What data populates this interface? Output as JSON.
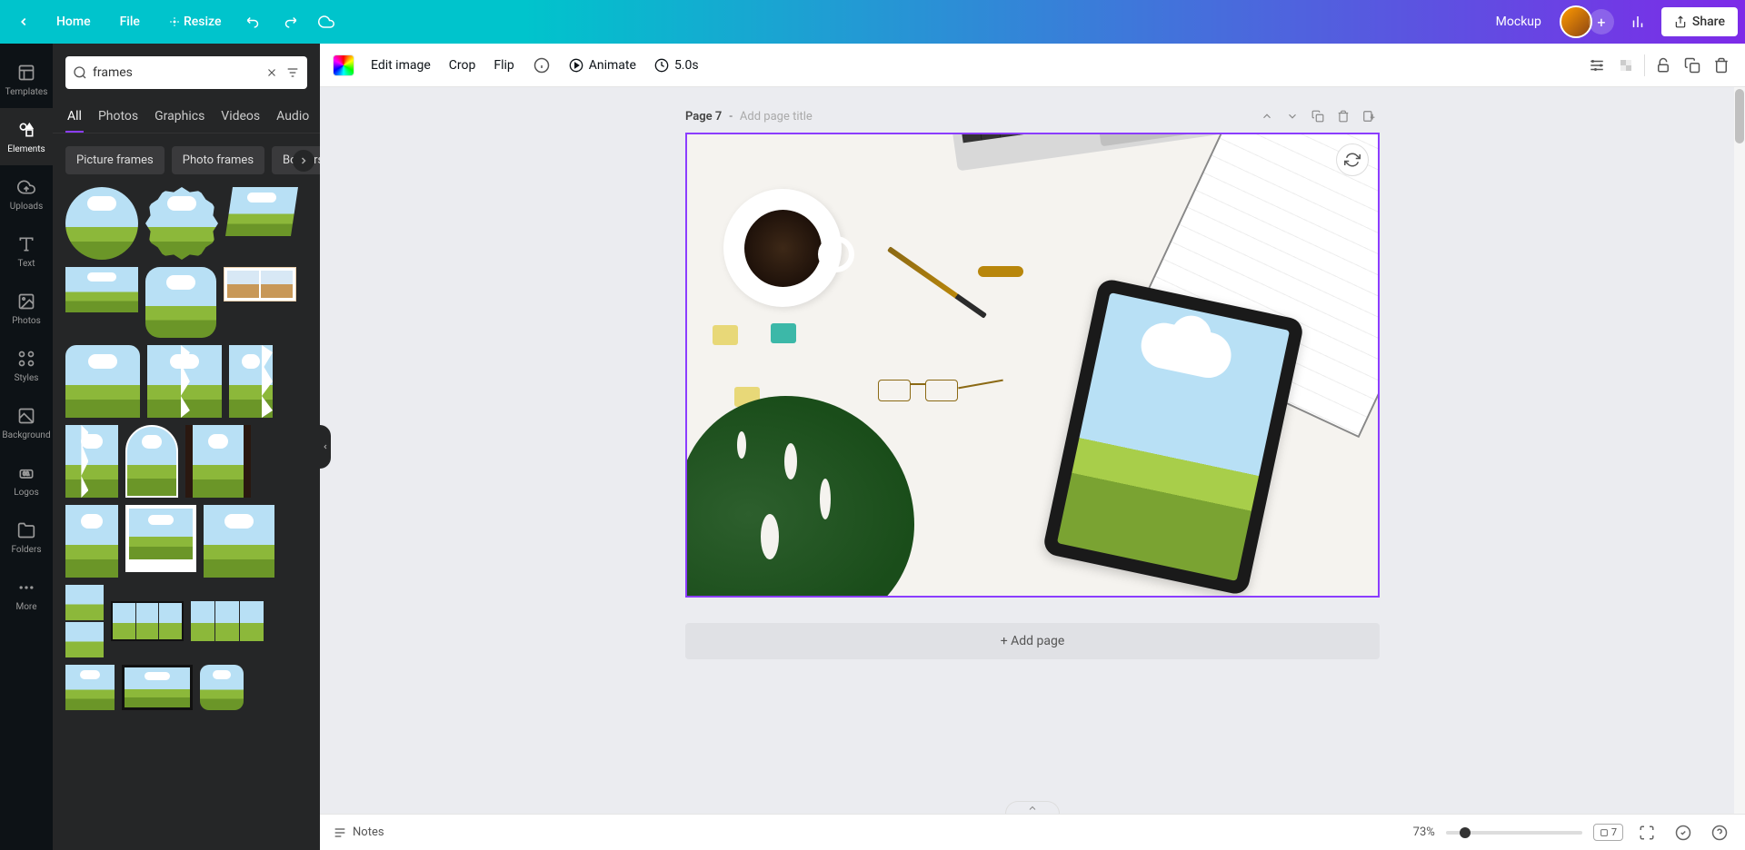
{
  "topbar": {
    "home": "Home",
    "file": "File",
    "resize": "Resize",
    "title": "Mockup",
    "share": "Share"
  },
  "leftnav": {
    "templates": "Templates",
    "elements": "Elements",
    "uploads": "Uploads",
    "text": "Text",
    "photos": "Photos",
    "styles": "Styles",
    "background": "Background",
    "logos": "Logos",
    "folders": "Folders",
    "more": "More"
  },
  "search": {
    "value": "frames"
  },
  "tabs": {
    "all": "All",
    "photos": "Photos",
    "graphics": "Graphics",
    "videos": "Videos",
    "audio": "Audio"
  },
  "chips": {
    "picture_frames": "Picture frames",
    "photo_frames": "Photo frames",
    "borders": "Borders"
  },
  "toolbar": {
    "edit_image": "Edit image",
    "crop": "Crop",
    "flip": "Flip",
    "animate": "Animate",
    "duration": "5.0s"
  },
  "page": {
    "label": "Page 7",
    "dash": " - ",
    "placeholder": "Add page title"
  },
  "addpage": "+ Add page",
  "bottom": {
    "notes": "Notes",
    "zoom": "73%",
    "pagecount": "7"
  }
}
